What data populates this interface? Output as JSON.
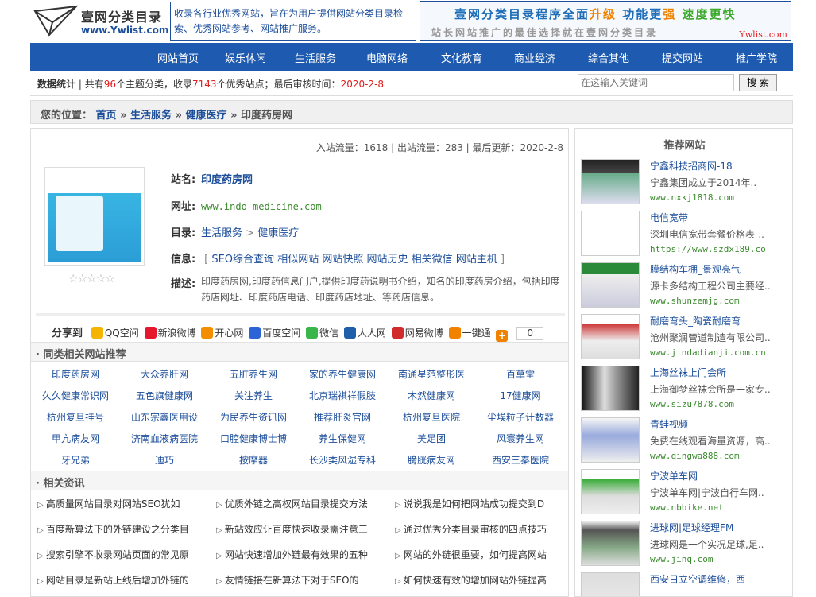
{
  "header": {
    "logo_title": "壹网分类目录",
    "logo_url": "www.Ywlist.com",
    "intro": "收录各行业优秀网站，旨在为用户提供网站分类目录检索、优秀网站参考、网站推广服务。",
    "banner_line1_a": "壹网分类目录程序全面",
    "banner_line1_b": "升级",
    "banner_line1_c": " 功能更",
    "banner_line1_d": "强",
    "banner_line1_e": " 速度更快",
    "banner_line2": "站长网站推广的最佳选择就在壹网分类目录",
    "banner_brand": "Ywlist.com"
  },
  "nav": [
    "网站首页",
    "娱乐休闲",
    "生活服务",
    "电脑网络",
    "文化教育",
    "商业经济",
    "综合其他",
    "提交网站",
    "推广学院"
  ],
  "stats": {
    "label": "数据统计",
    "text1": " | 共有",
    "topics": "96",
    "text2": "个主题分类，收录",
    "sites": "7143",
    "text3": "个优秀站点；最后审核时间：",
    "date": "2020-2-8",
    "search_placeholder": "在这输入关键词",
    "search_button": "搜 索"
  },
  "breadcrumb": {
    "prefix": "您的位置：",
    "items": [
      "首页",
      "生活服务",
      "健康医疗"
    ],
    "current": "印度药房网",
    "sep": "»"
  },
  "site": {
    "flow": "入站流量：1618 | 出站流量：283 | 最后更新：2020-2-8",
    "stars": "☆☆☆☆☆",
    "name_label": "站名:",
    "name": "印度药房网",
    "url_label": "网址:",
    "url": "www.indo-medicine.com",
    "dir_label": "目录:",
    "dir_cat": "生活服务",
    "dir_sep": ">",
    "dir_sub": "健康医疗",
    "info_label": "信息:",
    "info_links": [
      "SEO综合查询",
      "相似网站",
      "网站快照",
      "网站历史",
      "相关微信",
      "网站主机"
    ],
    "desc_label": "描述:",
    "desc": "印度药房网,印度药信息门户,提供印度药说明书介绍，知名的印度药房介绍，包括印度药店网址、印度药店电话、印度药店地址、等药店信息。"
  },
  "share": {
    "label": "分享到",
    "items": [
      {
        "name": "QQ空间",
        "color": "#f5b400"
      },
      {
        "name": "新浪微博",
        "color": "#e6162d"
      },
      {
        "name": "开心网",
        "color": "#f28e00"
      },
      {
        "name": "百度空间",
        "color": "#2c64d8"
      },
      {
        "name": "微信",
        "color": "#3ab54a"
      },
      {
        "name": "人人网",
        "color": "#1f5fa9"
      },
      {
        "name": "网易微博",
        "color": "#d12b2b"
      },
      {
        "name": "一键通",
        "color": "#f08200"
      }
    ],
    "count": "0"
  },
  "similar": {
    "title": "同类相关网站推荐",
    "rows": [
      [
        "印度药房网",
        "大众养肝网",
        "五脏养生网",
        "家的养生健康网",
        "南通星范整形医",
        "百草堂"
      ],
      [
        "久久健康常识网",
        "五色旗健康网",
        "关注养生",
        "北京瑞祺祥假肢",
        "木然健康网",
        "17健康网"
      ],
      [
        "杭州复旦挂号",
        "山东宗鑫医用设",
        "为民养生资讯网",
        "推荐肝炎官网",
        "杭州复旦医院",
        "尘埃粒子计数器"
      ],
      [
        "甲亢病友网",
        "济南血液病医院",
        "口腔健康博士博",
        "养生保健网",
        "美足团",
        "风寰养生网"
      ],
      [
        "牙兄弟",
        "迪巧",
        "按摩器",
        "长沙类风湿专科",
        "膀胱病友网",
        "西安三秦医院"
      ]
    ]
  },
  "news": {
    "title": "相关资讯",
    "rows": [
      [
        "高质量网站目录对网站SEO犹如",
        "优质外链之高权网站目录提交方法",
        "说说我是如何把网站成功提交到D"
      ],
      [
        "百度新算法下的外链建设之分类目",
        "新站效应让百度快速收录需注意三",
        "通过优秀分类目录审核的四点技巧"
      ],
      [
        "搜索引擎不收录网站页面的常见原",
        "网站快速增加外链最有效果的五种",
        "网站的外链很重要，如何提高网站"
      ],
      [
        "网站目录是新站上线后增加外链的",
        "友情链接在新算法下对于SEO的",
        "如何快速有效的增加网站外链提高"
      ]
    ]
  },
  "recommend": {
    "title": "推荐网站",
    "items": [
      {
        "name": "宁鑫科技招商网-18",
        "desc": "宁鑫集团成立于2014年..",
        "url": "www.nxkj1818.com"
      },
      {
        "name": "电信宽带",
        "desc": "深圳电信宽带套餐价格表-..",
        "url": "https://www.szdx189.co"
      },
      {
        "name": "膜结构车棚_景观亮气",
        "desc": "源卡多结构工程公司主要经..",
        "url": "www.shunzemjg.com"
      },
      {
        "name": "耐磨弯头_陶瓷耐磨弯",
        "desc": "沧州聚润管道制造有限公司..",
        "url": "www.jindadianji.com.cn"
      },
      {
        "name": "上海丝袜上门会所",
        "desc": "上海御梦丝袜会所是一家专..",
        "url": "www.sizu7878.com"
      },
      {
        "name": "青蛙视频",
        "desc": "免费在线观看海量资源，高..",
        "url": "www.qingwa888.com"
      },
      {
        "name": "宁波单车网",
        "desc": "宁波单车网|宁波自行车网..",
        "url": "www.nbbike.net"
      },
      {
        "name": "进球网|足球经理FM",
        "desc": "进球网是一个实况足球,足..",
        "url": "www.jinq.com"
      },
      {
        "name": "西安日立空调维修，西",
        "desc": "",
        "url": ""
      }
    ]
  }
}
